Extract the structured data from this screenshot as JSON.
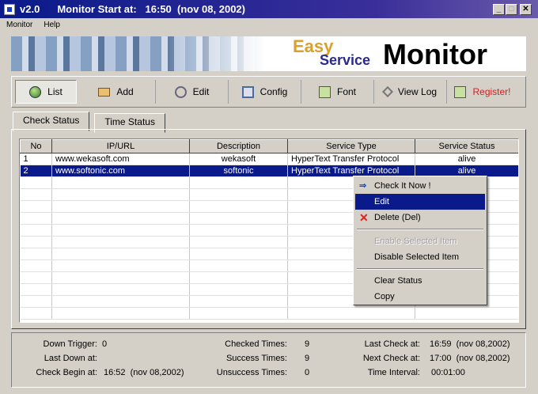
{
  "titlebar": {
    "version": "v2.0",
    "title": "Monitor Start at:   16:50  (nov 08, 2002)",
    "minimize": "_",
    "maximize": "□",
    "close": "✕"
  },
  "menu": [
    "Monitor",
    "Help"
  ],
  "banner": {
    "easy": "Easy",
    "service": "Service",
    "monitor": "Monitor"
  },
  "toolbar": [
    {
      "label": "List",
      "icon": "globe-icon"
    },
    {
      "label": "Add",
      "icon": "add-icon"
    },
    {
      "label": "Edit",
      "icon": "edit-icon"
    },
    {
      "label": "Config",
      "icon": "config-icon"
    },
    {
      "label": "Font",
      "icon": "font-icon"
    },
    {
      "label": "View Log",
      "icon": "log-icon"
    },
    {
      "label": "Register!",
      "icon": "register-icon"
    }
  ],
  "tabs": [
    "Check Status",
    "Time Status"
  ],
  "table": {
    "columns": [
      "No",
      "IP/URL",
      "Description",
      "Service Type",
      "Service Status"
    ],
    "rows": [
      [
        "1",
        "www.wekasoft.com",
        "wekasoft",
        "HyperText Transfer Protocol",
        "alive"
      ],
      [
        "2",
        "www.softonic.com",
        "softonic",
        "HyperText Transfer Protocol",
        "alive"
      ]
    ]
  },
  "context_menu": {
    "check": "Check It Now !",
    "edit": "Edit",
    "delete": "Delete  (Del)",
    "enable": "Enable Selected Item",
    "disable": "Disable Selected Item",
    "clear": "Clear Status",
    "copy": "Copy"
  },
  "status": {
    "down_trigger_label": "Down Trigger:",
    "down_trigger": "0",
    "last_down_label": "Last Down at:",
    "last_down": "",
    "check_begin_label": "Check Begin at:",
    "check_begin": "16:52  (nov 08,2002)",
    "checked_label": "Checked Times:",
    "checked": "9",
    "success_label": "Success Times:",
    "success": "9",
    "unsuccess_label": "Unsuccess Times:",
    "unsuccess": "0",
    "last_check_label": "Last Check at:",
    "last_check": "16:59  (nov 08,2002)",
    "next_check_label": "Next Check at:",
    "next_check": "17:00  (nov 08,2002)",
    "interval_label": "Time Interval:",
    "interval": "00:01:00"
  }
}
